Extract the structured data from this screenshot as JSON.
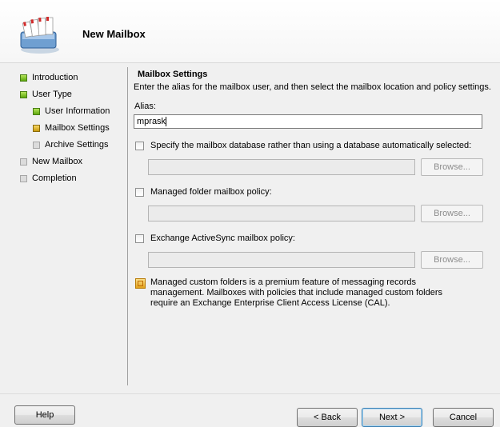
{
  "header": {
    "title": "New Mailbox",
    "icon": "mailbox-wizard-icon"
  },
  "nav": {
    "items": [
      {
        "label": "Introduction",
        "status": "complete"
      },
      {
        "label": "User Type",
        "status": "complete"
      },
      {
        "label": "User Information",
        "status": "complete"
      },
      {
        "label": "Mailbox Settings",
        "status": "current"
      },
      {
        "label": "Archive Settings",
        "status": "pending"
      },
      {
        "label": "New Mailbox",
        "status": "pending"
      },
      {
        "label": "Completion",
        "status": "pending"
      }
    ]
  },
  "main": {
    "section_title": "Mailbox Settings",
    "description": "Enter the alias for the mailbox user, and then select the mailbox location and policy settings.",
    "alias": {
      "label": "Alias:",
      "value": "mprask"
    },
    "options": [
      {
        "label": "Specify the mailbox database rather than using a database automatically selected:",
        "checked": false,
        "field_value": "",
        "browse_label": "Browse..."
      },
      {
        "label": "Managed folder mailbox policy:",
        "checked": false,
        "field_value": "",
        "browse_label": "Browse..."
      },
      {
        "label": "Exchange ActiveSync mailbox policy:",
        "checked": false,
        "field_value": "",
        "browse_label": "Browse..."
      }
    ],
    "info_text": "Managed custom folders is a premium feature of messaging records management. Mailboxes with policies that include managed custom folders require an Exchange Enterprise Client Access License (CAL)."
  },
  "footer": {
    "help": "Help",
    "back": "< Back",
    "next": "Next >",
    "cancel": "Cancel"
  },
  "colors": {
    "complete": "#5ea80e",
    "current": "#c89a0c",
    "pending": "#dcdcdc"
  }
}
